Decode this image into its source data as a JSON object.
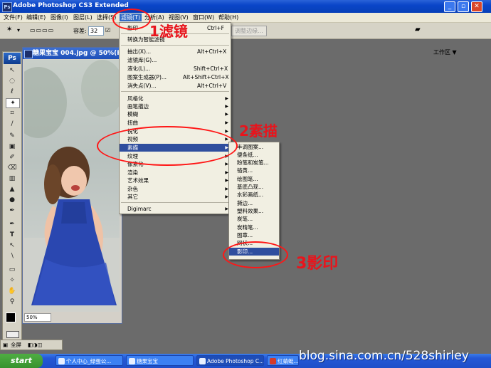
{
  "window": {
    "title": "Adobe Photoshop CS3 Extended",
    "logo": "Ps",
    "minimize_label": "_",
    "restore_label": "▫",
    "close_label": "✕"
  },
  "menubar": {
    "items": [
      "文件(F)",
      "编辑(E)",
      "图像(I)",
      "图层(L)",
      "选择(S)",
      "滤镜(T)",
      "分析(A)",
      "视图(V)",
      "窗口(W)",
      "帮助(H)"
    ],
    "active": "滤镜(T)"
  },
  "options": {
    "tolerance_label": "容差:",
    "tolerance_value": "32",
    "refine_edge": "调整边缘...",
    "workspace_label": "工作区 ▼"
  },
  "toolbox": {
    "logo": "Ps",
    "tools": [
      "↖",
      "◌",
      "ℓ",
      "✦",
      "⌗",
      "∕",
      "✎",
      "▣",
      "✐",
      "⌫",
      "▥",
      "▲",
      "●",
      "✒",
      "T",
      "↖",
      "∖",
      "▭",
      "✧",
      "✋",
      "⚲"
    ]
  },
  "document": {
    "title": "糖果宝宝 004.jpg @ 50%(R",
    "zoom": "50%"
  },
  "filter_menu": {
    "items": [
      {
        "label": "影印",
        "shortcut": "Ctrl+F"
      },
      {
        "label": "转换为智能滤镜",
        "shortcut": ""
      },
      {
        "label": "抽出(X)...",
        "shortcut": "Alt+Ctrl+X"
      },
      {
        "label": "滤镜库(G)...",
        "shortcut": ""
      },
      {
        "label": "液化(L)...",
        "shortcut": "Shift+Ctrl+X"
      },
      {
        "label": "图案生成器(P)...",
        "shortcut": "Alt+Shift+Ctrl+X"
      },
      {
        "label": "消失点(V)...",
        "shortcut": "Alt+Ctrl+V"
      },
      {
        "label": "风格化",
        "shortcut": ""
      },
      {
        "label": "画笔描边",
        "shortcut": ""
      },
      {
        "label": "模糊",
        "shortcut": ""
      },
      {
        "label": "扭曲",
        "shortcut": ""
      },
      {
        "label": "锐化",
        "shortcut": ""
      },
      {
        "label": "视频",
        "shortcut": ""
      },
      {
        "label": "素描",
        "shortcut": ""
      },
      {
        "label": "纹理",
        "shortcut": ""
      },
      {
        "label": "像素化",
        "shortcut": ""
      },
      {
        "label": "渲染",
        "shortcut": ""
      },
      {
        "label": "艺术效果",
        "shortcut": ""
      },
      {
        "label": "杂色",
        "shortcut": ""
      },
      {
        "label": "其它",
        "shortcut": ""
      },
      {
        "label": "Digimarc",
        "shortcut": ""
      }
    ],
    "selected": "素描"
  },
  "sketch_submenu": {
    "items": [
      "半调图案...",
      "便条纸...",
      "粉笔和炭笔...",
      "铬黄...",
      "绘图笔...",
      "基底凸现...",
      "水彩画纸...",
      "撕边...",
      "塑料效果...",
      "炭笔...",
      "炭精笔...",
      "图章...",
      "网状...",
      "影印..."
    ],
    "selected": "影印..."
  },
  "annotations": {
    "step1": "1滤镜",
    "step2": "2素描",
    "step3": "3影印"
  },
  "taskbar": {
    "start": "start",
    "tasks": [
      "个人中心_绿蛋公...",
      "糖果宝宝",
      "Adobe Photoshop C...",
      "红蜻蜓..."
    ],
    "status_tabs": [
      "全屏"
    ]
  },
  "watermark": "blog.sina.com.cn/528shirley",
  "colors": {
    "titlebar": "#0a45c8",
    "menu_highlight": "#2f4e9e",
    "annotation_red": "#e8141c",
    "workspace_bg": "#6b6b6b"
  }
}
